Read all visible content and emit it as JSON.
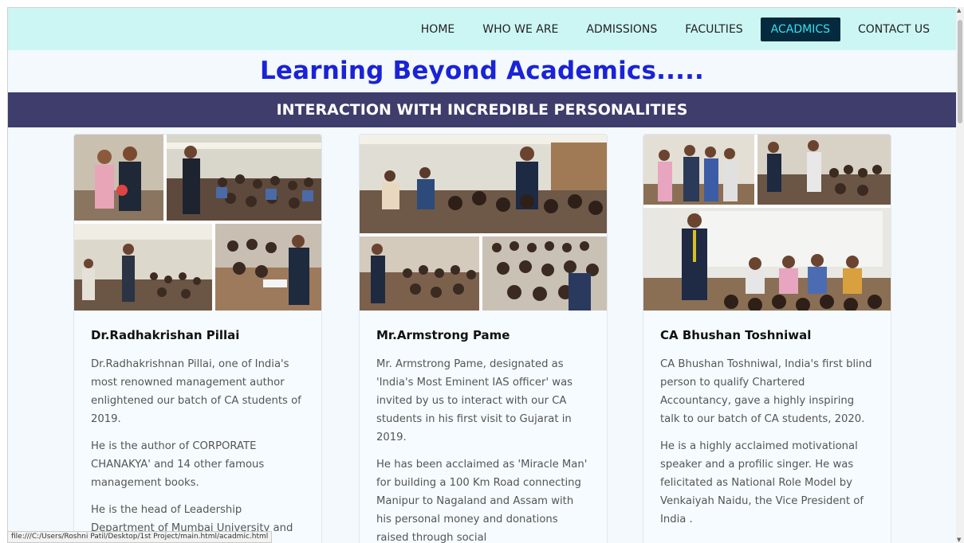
{
  "nav": {
    "items": [
      {
        "label": "HOME"
      },
      {
        "label": "WHO WE ARE"
      },
      {
        "label": "ADMISSIONS"
      },
      {
        "label": "FACULTIES"
      },
      {
        "label": "ACADMICS"
      },
      {
        "label": "CONTACT US"
      }
    ],
    "active_index": 4
  },
  "page": {
    "heading": "Learning Beyond Academics.....",
    "banner": "INTERACTION WITH INCREDIBLE PERSONALITIES"
  },
  "cards": [
    {
      "title": "Dr.Radhakrishan Pillai",
      "paragraphs": [
        "Dr.Radhakrishnan Pillai, one of India's most renowned management author enlightened our batch of CA students of 2019.",
        "He is the author of CORPORATE CHANAKYA' and 14 other famous management books.",
        "He is the head of Leadership Department of Mumbai University and"
      ]
    },
    {
      "title": "Mr.Armstrong Pame",
      "paragraphs": [
        "Mr. Armstrong Pame, designated as 'India's Most Eminent IAS officer' was invited by us to interact with our CA students in his first visit to Gujarat in 2019.",
        "He has been acclaimed as 'Miracle Man' for building a 100 Km Road connecting Manipur to Nagaland and Assam with his personal money and donations raised through social"
      ]
    },
    {
      "title": "CA Bhushan Toshniwal",
      "paragraphs": [
        "CA Bhushan Toshniwal, India's first blind person to qualify Chartered Accountancy, gave a highly inspiring talk to our batch of CA students, 2020.",
        "He is a highly acclaimed motivational speaker and a profilic singer. He was felicitated as National Role Model by Venkaiyah Naidu, the Vice President of India ."
      ]
    }
  ],
  "status_bar": {
    "url": "file:///C:/Users/Roshni Patil/Desktop/1st Project/main.html/acadmic.html"
  },
  "colors": {
    "navbar_bg": "#ccf6f3",
    "active_nav_bg": "#052a3d",
    "active_nav_text": "#36e0ef",
    "heading": "#1a23d6",
    "banner_bg": "#3e3d6b",
    "page_bg": "#f3f9fd"
  }
}
